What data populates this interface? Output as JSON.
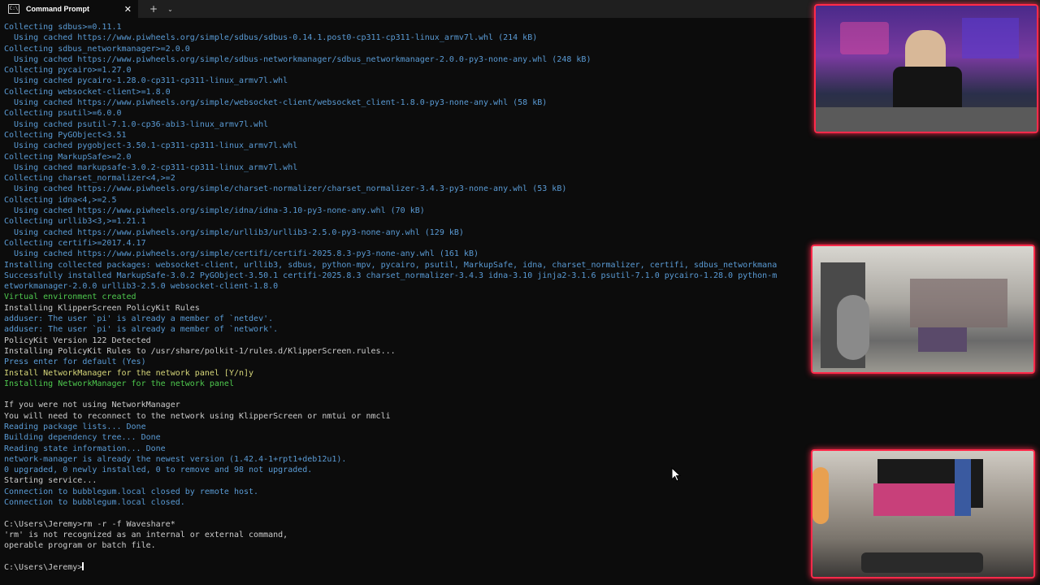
{
  "window": {
    "tab_title": "Command Prompt",
    "tab_icon": "C:\\",
    "close_glyph": "✕",
    "new_tab_glyph": "+",
    "dropdown_glyph": "⌄"
  },
  "terminal": {
    "lines": [
      {
        "text": "Collecting sdbus>=0.11.1",
        "color": "#5a9bd5"
      },
      {
        "text": "  Using cached https://www.piwheels.org/simple/sdbus/sdbus-0.14.1.post0-cp311-cp311-linux_armv7l.whl (214 kB)",
        "color": "#5a9bd5"
      },
      {
        "text": "Collecting sdbus_networkmanager>=2.0.0",
        "color": "#5a9bd5"
      },
      {
        "text": "  Using cached https://www.piwheels.org/simple/sdbus-networkmanager/sdbus_networkmanager-2.0.0-py3-none-any.whl (248 kB)",
        "color": "#5a9bd5"
      },
      {
        "text": "Collecting pycairo>=1.27.0",
        "color": "#5a9bd5"
      },
      {
        "text": "  Using cached pycairo-1.28.0-cp311-cp311-linux_armv7l.whl",
        "color": "#5a9bd5"
      },
      {
        "text": "Collecting websocket-client>=1.8.0",
        "color": "#5a9bd5"
      },
      {
        "text": "  Using cached https://www.piwheels.org/simple/websocket-client/websocket_client-1.8.0-py3-none-any.whl (58 kB)",
        "color": "#5a9bd5"
      },
      {
        "text": "Collecting psutil>=6.0.0",
        "color": "#5a9bd5"
      },
      {
        "text": "  Using cached psutil-7.1.0-cp36-abi3-linux_armv7l.whl",
        "color": "#5a9bd5"
      },
      {
        "text": "Collecting PyGObject<3.51",
        "color": "#5a9bd5"
      },
      {
        "text": "  Using cached pygobject-3.50.1-cp311-cp311-linux_armv7l.whl",
        "color": "#5a9bd5"
      },
      {
        "text": "Collecting MarkupSafe>=2.0",
        "color": "#5a9bd5"
      },
      {
        "text": "  Using cached markupsafe-3.0.2-cp311-cp311-linux_armv7l.whl",
        "color": "#5a9bd5"
      },
      {
        "text": "Collecting charset_normalizer<4,>=2",
        "color": "#5a9bd5"
      },
      {
        "text": "  Using cached https://www.piwheels.org/simple/charset-normalizer/charset_normalizer-3.4.3-py3-none-any.whl (53 kB)",
        "color": "#5a9bd5"
      },
      {
        "text": "Collecting idna<4,>=2.5",
        "color": "#5a9bd5"
      },
      {
        "text": "  Using cached https://www.piwheels.org/simple/idna/idna-3.10-py3-none-any.whl (70 kB)",
        "color": "#5a9bd5"
      },
      {
        "text": "Collecting urllib3<3,>=1.21.1",
        "color": "#5a9bd5"
      },
      {
        "text": "  Using cached https://www.piwheels.org/simple/urllib3/urllib3-2.5.0-py3-none-any.whl (129 kB)",
        "color": "#5a9bd5"
      },
      {
        "text": "Collecting certifi>=2017.4.17",
        "color": "#5a9bd5"
      },
      {
        "text": "  Using cached https://www.piwheels.org/simple/certifi/certifi-2025.8.3-py3-none-any.whl (161 kB)",
        "color": "#5a9bd5"
      },
      {
        "text": "Installing collected packages: websocket-client, urllib3, sdbus, python-mpv, pycairo, psutil, MarkupSafe, idna, charset_normalizer, certifi, sdbus_networkmana",
        "color": "#5a9bd5"
      },
      {
        "text": "Successfully installed MarkupSafe-3.0.2 PyGObject-3.50.1 certifi-2025.8.3 charset_normalizer-3.4.3 idna-3.10 jinja2-3.1.6 psutil-7.1.0 pycairo-1.28.0 python-m",
        "color": "#5a9bd5"
      },
      {
        "text": "etworkmanager-2.0.0 urllib3-2.5.0 websocket-client-1.8.0",
        "color": "#5a9bd5"
      },
      {
        "text": "Virtual environment created",
        "color": "#4ec94e"
      },
      {
        "text": "Installing KlipperScreen PolicyKit Rules",
        "color": "#cccccc"
      },
      {
        "text": "adduser: The user `pi' is already a member of `netdev'.",
        "color": "#5a9bd5"
      },
      {
        "text": "adduser: The user `pi' is already a member of `network'.",
        "color": "#5a9bd5"
      },
      {
        "text": "PolicyKit Version 122 Detected",
        "color": "#cccccc"
      },
      {
        "text": "Installing PolicyKit Rules to /usr/share/polkit-1/rules.d/KlipperScreen.rules...",
        "color": "#cccccc"
      },
      {
        "text": "Press enter for default (Yes)",
        "color": "#5a9bd5"
      },
      {
        "text": "Install NetworkManager for the network panel [Y/n]y",
        "color": "#d7d77a"
      },
      {
        "text": "Installing NetworkManager for the network panel",
        "color": "#4ec94e"
      },
      {
        "text": "",
        "color": "#cccccc"
      },
      {
        "text": "If you were not using NetworkManager",
        "color": "#cccccc"
      },
      {
        "text": "You will need to reconnect to the network using KlipperScreen or nmtui or nmcli",
        "color": "#cccccc"
      },
      {
        "text": "Reading package lists... Done",
        "color": "#5a9bd5"
      },
      {
        "text": "Building dependency tree... Done",
        "color": "#5a9bd5"
      },
      {
        "text": "Reading state information... Done",
        "color": "#5a9bd5"
      },
      {
        "text": "network-manager is already the newest version (1.42.4-1+rpt1+deb12u1).",
        "color": "#5a9bd5"
      },
      {
        "text": "0 upgraded, 0 newly installed, 0 to remove and 98 not upgraded.",
        "color": "#5a9bd5"
      },
      {
        "text": "Starting service...",
        "color": "#cccccc"
      },
      {
        "text": "Connection to bubblegum.local closed by remote host.",
        "color": "#5a9bd5"
      },
      {
        "text": "Connection to bubblegum.local closed.",
        "color": "#5a9bd5"
      },
      {
        "text": "",
        "color": "#cccccc"
      },
      {
        "text": "C:\\Users\\Jeremy>rm -r -f Waveshare*",
        "color": "#cccccc"
      },
      {
        "text": "'rm' is not recognized as an internal or external command,",
        "color": "#cccccc"
      },
      {
        "text": "operable program or batch file.",
        "color": "#cccccc"
      },
      {
        "text": "",
        "color": "#cccccc"
      }
    ],
    "prompt": "C:\\Users\\Jeremy>"
  },
  "colors": {
    "background": "#0c0c0c",
    "tab_bar": "#1f1f1f",
    "overlay_border": "#ff2a4a"
  }
}
